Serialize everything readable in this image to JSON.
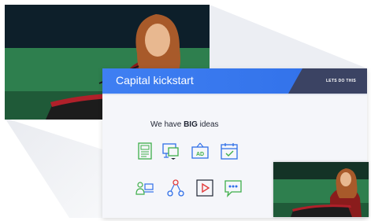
{
  "slide": {
    "title": "Capital kickstart",
    "tag": "LETS DO THIS",
    "headline_prefix": "We have ",
    "headline_bold": "BIG",
    "headline_suffix": " ideas"
  },
  "icons": {
    "row1": [
      "document-icon",
      "presentation-icon",
      "ad-billboard-icon",
      "calendar-check-icon"
    ],
    "row2": [
      "team-computer-icon",
      "network-nodes-icon",
      "play-video-icon",
      "chat-bubble-icon"
    ],
    "ad_label": "AD"
  },
  "colors": {
    "header_blue": "#3f7ff2",
    "header_dark": "#3b4363",
    "icon_green": "#3fae4a",
    "icon_blue": "#2f6fe8",
    "icon_red": "#e23b3b",
    "stage_green": "#2f7a4a"
  }
}
